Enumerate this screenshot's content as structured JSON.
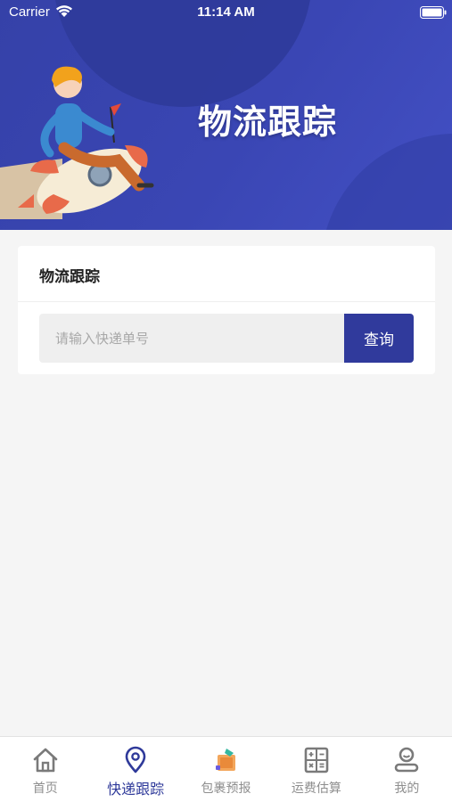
{
  "status_bar": {
    "carrier": "Carrier",
    "time": "11:14 AM"
  },
  "banner": {
    "title": "物流跟踪"
  },
  "card": {
    "title": "物流跟踪",
    "search": {
      "placeholder": "请输入快递单号",
      "value": "",
      "button_label": "查询"
    }
  },
  "tab_bar": {
    "items": [
      {
        "label": "首页",
        "icon": "home-icon",
        "active": false
      },
      {
        "label": "快递跟踪",
        "icon": "location-pin-icon",
        "active": true
      },
      {
        "label": "包裹预报",
        "icon": "package-icon",
        "active": false
      },
      {
        "label": "运费估算",
        "icon": "calculator-icon",
        "active": false
      },
      {
        "label": "我的",
        "icon": "user-icon",
        "active": false
      }
    ]
  },
  "colors": {
    "primary": "#303a9c",
    "banner": "#3a46b4",
    "background": "#f5f5f5",
    "inactive_tab": "#8e8e8e"
  }
}
